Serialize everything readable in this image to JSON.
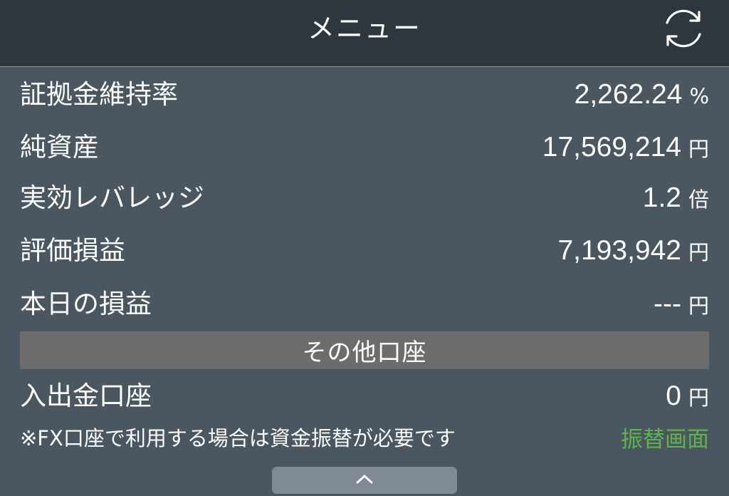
{
  "header": {
    "title": "メニュー",
    "refresh_icon": "refresh-icon"
  },
  "account": {
    "rows": [
      {
        "label": "証拠金維持率",
        "value": "2,262.24",
        "unit": "%"
      },
      {
        "label": "純資産",
        "value": "17,569,214",
        "unit": "円"
      },
      {
        "label": "実効レバレッジ",
        "value": "1.2",
        "unit": "倍"
      },
      {
        "label": "評価損益",
        "value": "7,193,942",
        "unit": "円"
      },
      {
        "label": "本日の損益",
        "value": "---",
        "unit": "円"
      }
    ]
  },
  "other_accounts": {
    "section_title": "その他口座",
    "deposit_row": {
      "label": "入出金口座",
      "value": "0",
      "unit": "円"
    },
    "note": "※FX口座で利用する場合は資金振替が必要です",
    "transfer_link": "振替画面"
  },
  "footer": {
    "collapse_icon": "chevron-up-icon"
  },
  "colors": {
    "header_bg": "#2e363e",
    "body_bg": "#4a5660",
    "section_bar_bg": "#6c6c6c",
    "link_green": "#5fb24f"
  }
}
